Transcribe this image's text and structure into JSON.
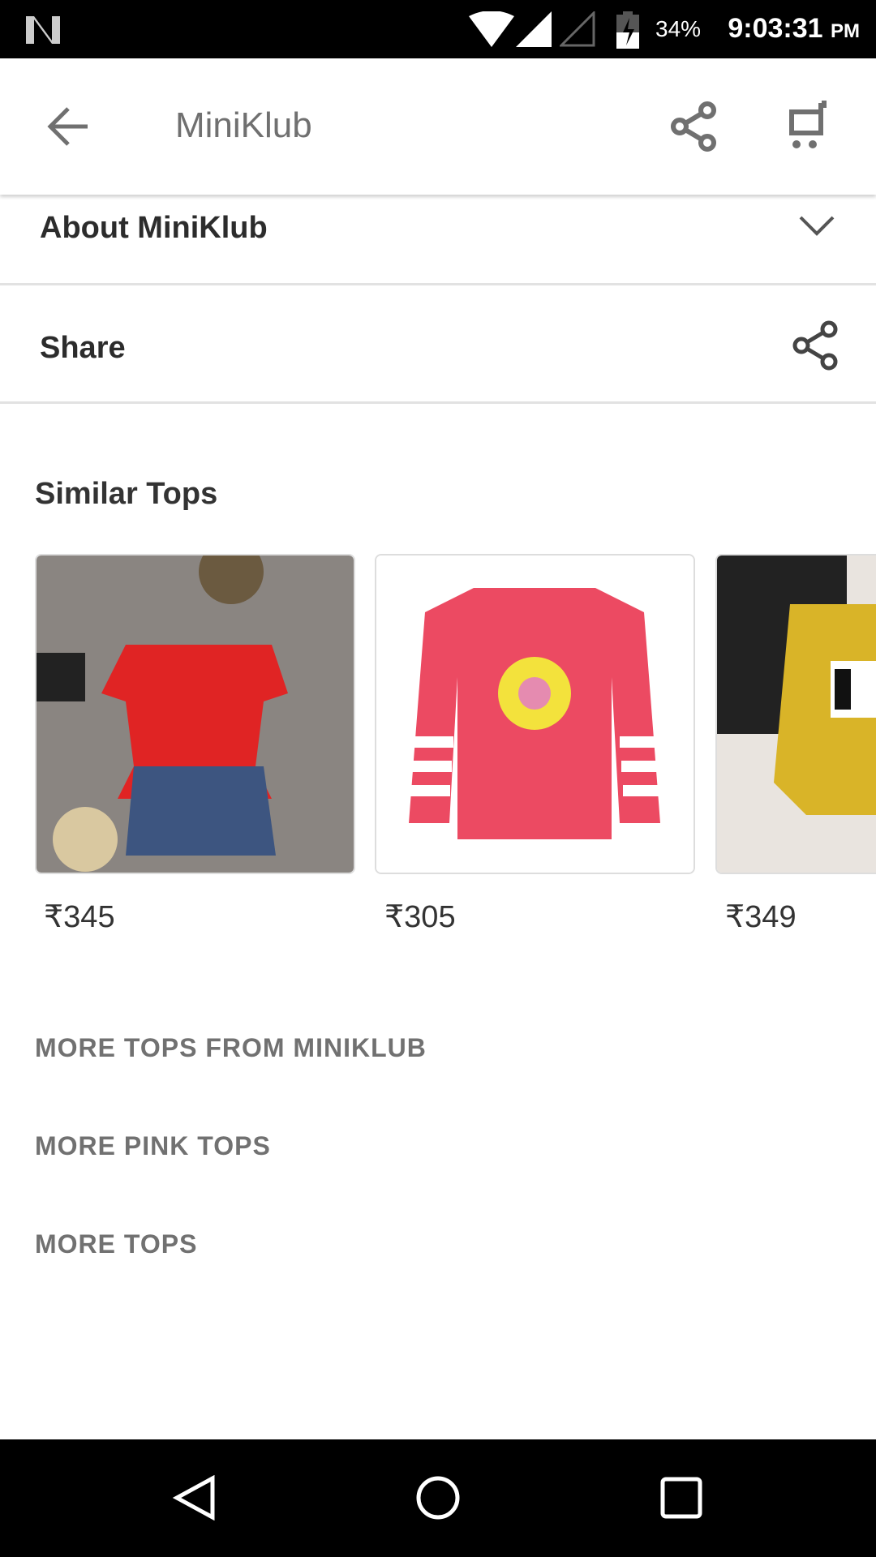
{
  "status_bar": {
    "battery": "34%",
    "time": "9:03:31",
    "ampm": "PM"
  },
  "app_bar": {
    "title": "MiniKlub",
    "icons": [
      "back-arrow-icon",
      "share-icon",
      "cart-icon"
    ]
  },
  "about": {
    "label": "About MiniKlub"
  },
  "share": {
    "label": "Share"
  },
  "similar": {
    "heading": "Similar Tops",
    "items": [
      {
        "price": "₹345"
      },
      {
        "price": "₹305"
      },
      {
        "price": "₹349"
      }
    ]
  },
  "links": [
    "MORE TOPS FROM MINIKLUB",
    "MORE PINK TOPS",
    "MORE TOPS"
  ],
  "colors": {
    "text": "#2c2c2c",
    "link": "#717171"
  }
}
